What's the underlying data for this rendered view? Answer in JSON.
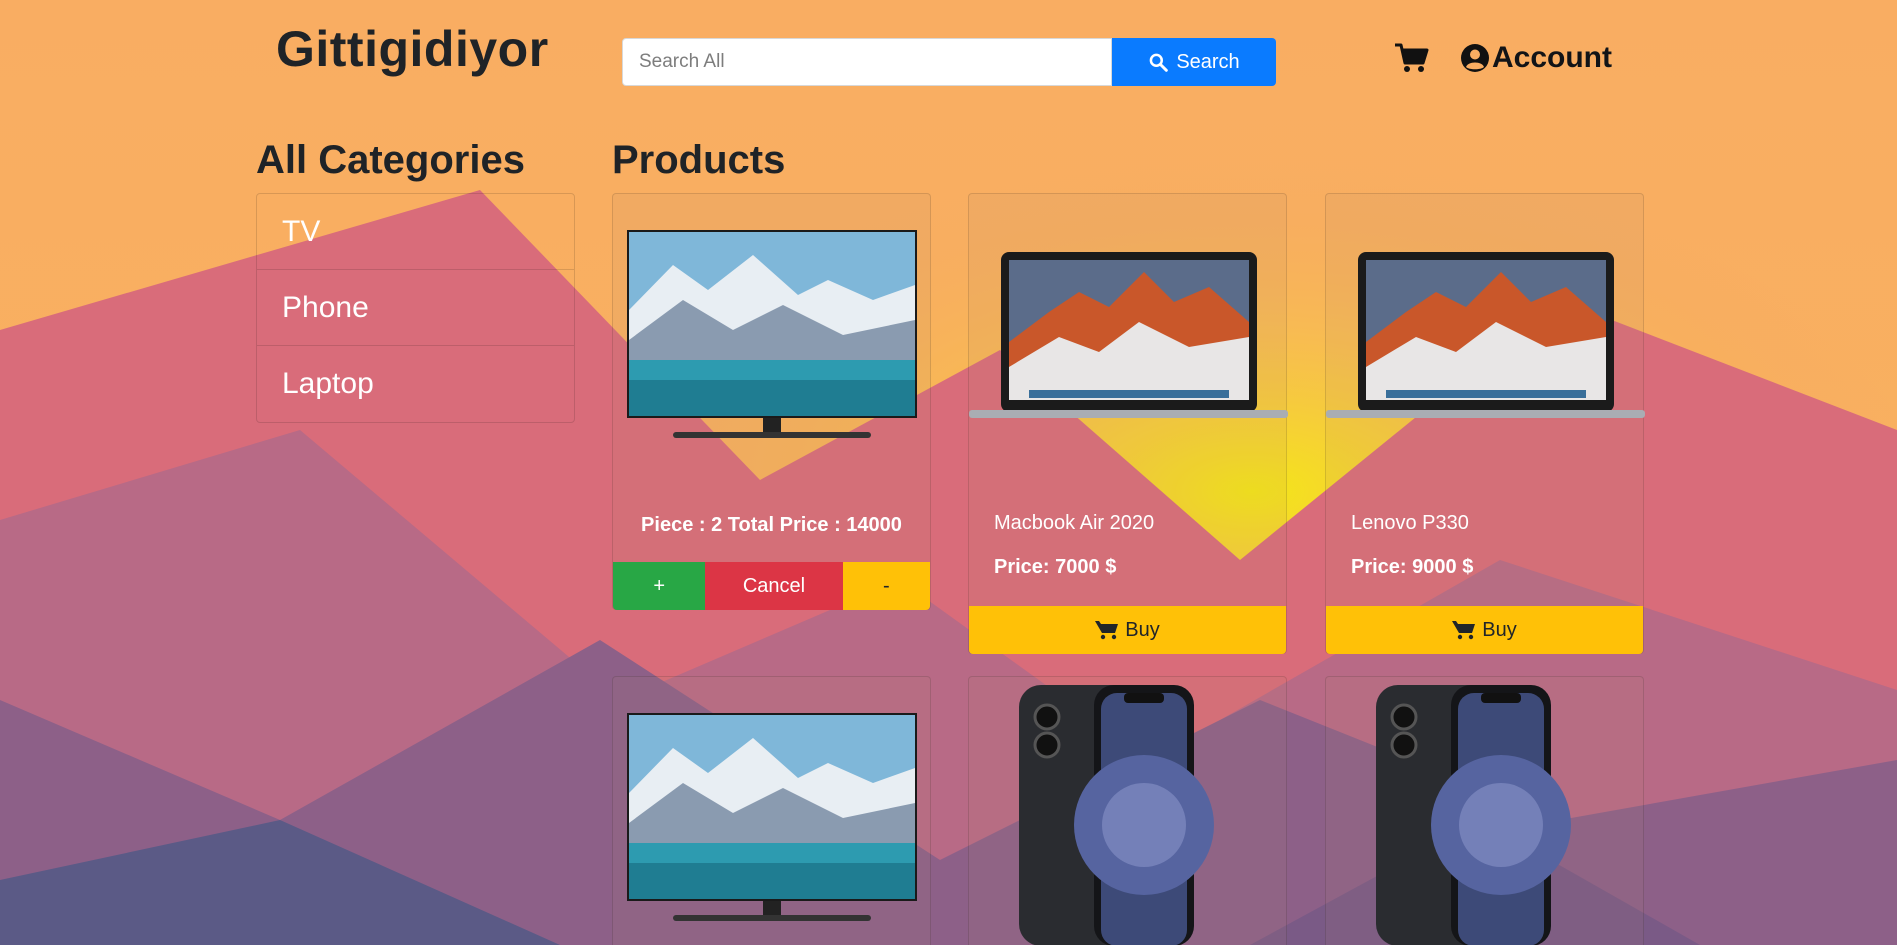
{
  "header": {
    "brand": "Gittigidiyor",
    "search_placeholder": "Search All",
    "search_label": "Search",
    "account_label": "Account"
  },
  "categories": {
    "title": "All Categories",
    "items": [
      {
        "label": "TV"
      },
      {
        "label": "Phone"
      },
      {
        "label": "Laptop"
      }
    ]
  },
  "products": {
    "title": "Products",
    "cards": [
      {
        "kind": "tv",
        "in_cart": true,
        "info": "Piece : 2 Total Price : 14000",
        "plus_label": "+",
        "cancel_label": "Cancel",
        "minus_label": "-"
      },
      {
        "kind": "laptop",
        "name": "Macbook Air 2020",
        "price": "Price: 7000 $",
        "buy_label": "Buy"
      },
      {
        "kind": "laptop",
        "name": "Lenovo P330",
        "price": "Price: 9000 $",
        "buy_label": "Buy"
      },
      {
        "kind": "tv"
      },
      {
        "kind": "phone"
      },
      {
        "kind": "phone"
      }
    ]
  },
  "colors": {
    "search_button": "#0a7bff",
    "buy_button": "#ffc107",
    "plus_button": "#28a745",
    "cancel_button": "#dc3545"
  }
}
